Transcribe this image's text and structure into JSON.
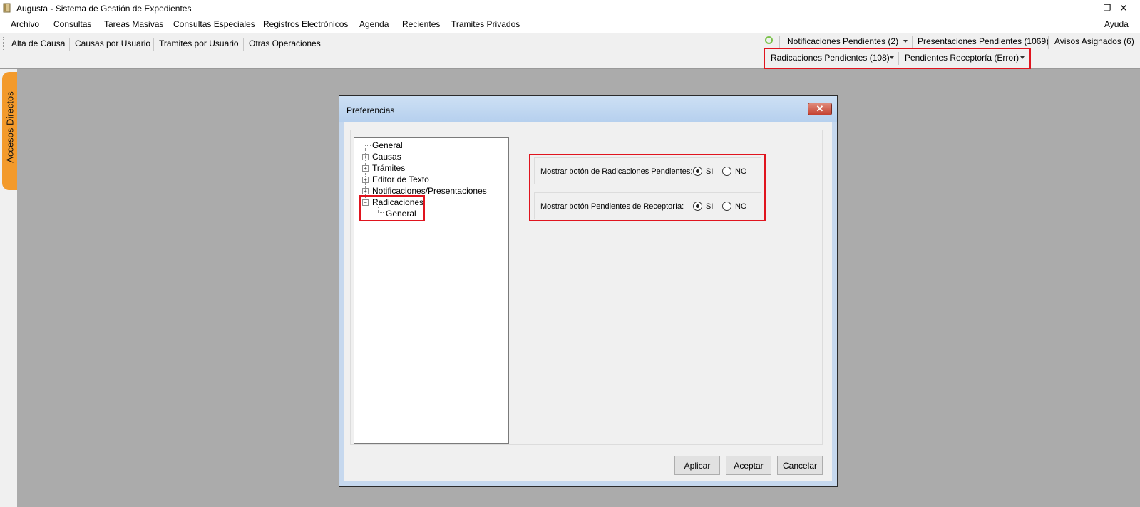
{
  "app": {
    "title": "Augusta - Sistema de Gestión de Expedientes",
    "help_label": "Ayuda"
  },
  "window_controls": {
    "minimize": "—",
    "restore": "❐",
    "close": "✕"
  },
  "menu": [
    "Archivo",
    "Consultas",
    "Tareas Masivas",
    "Consultas Especiales",
    "Registros Electrónicos",
    "Agenda",
    "Recientes",
    "Tramites Privados"
  ],
  "toolbar": [
    "Alta de Causa",
    "Causas por Usuario",
    "Tramites por Usuario",
    "Otras Operaciones"
  ],
  "notifications": {
    "row1": [
      "Notificaciones Pendientes (2)",
      "Presentaciones Pendientes (1069)",
      "Avisos Asignados (6)"
    ],
    "row2": [
      "Radicaciones Pendientes (108)",
      "Pendientes Receptoría (Error)"
    ]
  },
  "side_tab": "Accesos Directos",
  "dialog": {
    "title": "Preferencias",
    "close_glyph": "✕",
    "tree": {
      "general": "General",
      "causas": "Causas",
      "tramites": "Trámites",
      "editor": "Editor de Texto",
      "notificaciones": "Notificaciones/Presentaciones",
      "radicaciones": "Radicaciones",
      "radicaciones_general": "General"
    },
    "expander_plus": "+",
    "expander_minus": "−",
    "options": [
      {
        "label": "Mostrar botón de Radicaciones Pendientes:",
        "yes": "SI",
        "no": "NO",
        "selected": "SI"
      },
      {
        "label": "Mostrar botón Pendientes de Receptoría:",
        "yes": "SI",
        "no": "NO",
        "selected": "SI"
      }
    ],
    "buttons": {
      "apply": "Aplicar",
      "accept": "Aceptar",
      "cancel": "Cancelar"
    }
  },
  "colors": {
    "highlight_box": "#e0141e",
    "side_tab": "#f39a2b",
    "background": "#ababab"
  },
  "icons": {
    "app": "book-icon",
    "refresh": "refresh-icon"
  }
}
